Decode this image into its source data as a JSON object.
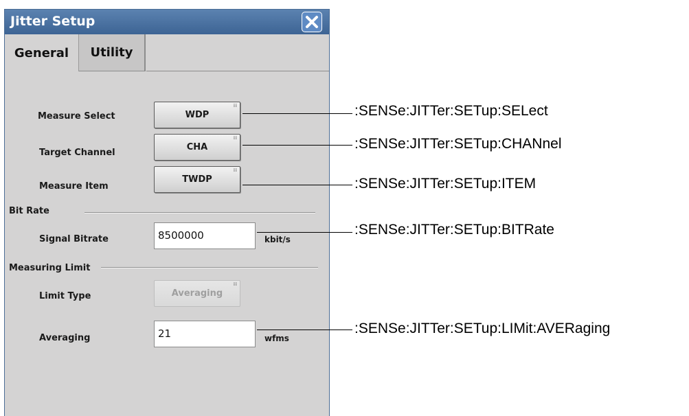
{
  "dialog": {
    "title": "Jitter Setup",
    "tabs": [
      "General",
      "Utility"
    ],
    "fields": {
      "measure_select": {
        "label": "Measure Select",
        "value": "WDP"
      },
      "target_channel": {
        "label": "Target Channel",
        "value": "CHA"
      },
      "measure_item": {
        "label": "Measure Item",
        "value": "TWDP"
      },
      "bit_rate_section": "Bit Rate",
      "signal_bitrate": {
        "label": "Signal Bitrate",
        "value": "8500000",
        "unit": "kbit/s"
      },
      "measuring_limit_section": "Measuring Limit",
      "limit_type": {
        "label": "Limit Type",
        "value": "Averaging"
      },
      "averaging": {
        "label": "Averaging",
        "value": "21",
        "unit": "wfms"
      }
    }
  },
  "callouts": [
    ":SENSe:JITTer:SETup:SELect",
    ":SENSe:JITTer:SETup:CHANnel",
    ":SENSe:JITTer:SETup:ITEM",
    ":SENSe:JITTer:SETup:BITRate",
    ":SENSe:JITTer:SETup:LIMit:AVERaging"
  ],
  "colors": {
    "titlebar": "#4a72a3",
    "dialog_bg": "#d4d3d3",
    "close_button": "#5f8bc4"
  }
}
